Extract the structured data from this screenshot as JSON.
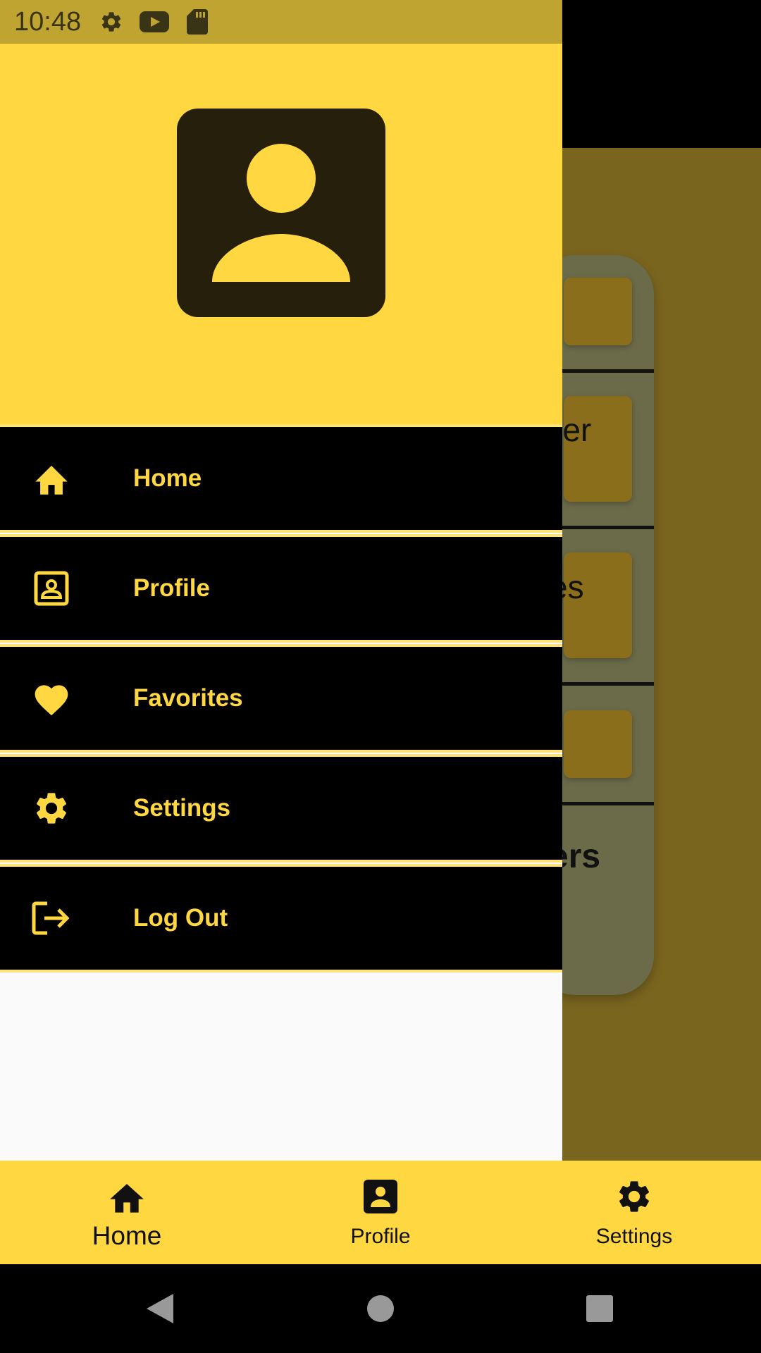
{
  "status_bar": {
    "time": "10:48",
    "icons": [
      "gear-icon",
      "youtube-icon",
      "sd-card-icon"
    ]
  },
  "background_screen": {
    "visible_fragments": [
      "ater",
      "es",
      "ers"
    ]
  },
  "drawer": {
    "header": {
      "icon": "account-box-icon"
    },
    "items": [
      {
        "label": "Home",
        "icon": "home-icon"
      },
      {
        "label": "Profile",
        "icon": "contact-card-icon"
      },
      {
        "label": "Favorites",
        "icon": "heart-icon"
      },
      {
        "label": "Settings",
        "icon": "gear-icon"
      },
      {
        "label": "Log Out",
        "icon": "logout-icon"
      }
    ]
  },
  "bottom_nav": {
    "items": [
      {
        "label": "Home",
        "icon": "home-icon",
        "active": true
      },
      {
        "label": "Profile",
        "icon": "account-box-icon",
        "active": false
      },
      {
        "label": "Settings",
        "icon": "gear-icon",
        "active": false
      }
    ]
  },
  "colors": {
    "accent": "#ffd740",
    "drawer_item_bg": "#000000",
    "status_bar": "#bfa431",
    "scrim_bg": "#7a651f"
  }
}
